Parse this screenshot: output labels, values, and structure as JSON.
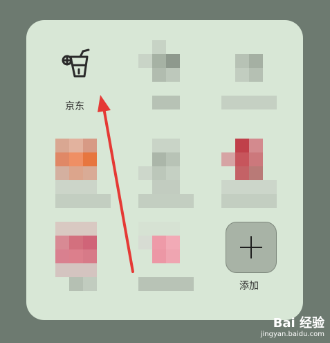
{
  "apps": [
    {
      "name": "京东",
      "icon": "drink-cup-icon"
    }
  ],
  "add_button": {
    "label": "添加",
    "icon": "plus-icon"
  },
  "watermark": {
    "line1": "Bai 经验",
    "line2": "jingyan.baidu.com"
  },
  "colors": {
    "background": "#6d7a70",
    "panel": "#d8e7d6",
    "annotation_arrow": "#e53935"
  }
}
